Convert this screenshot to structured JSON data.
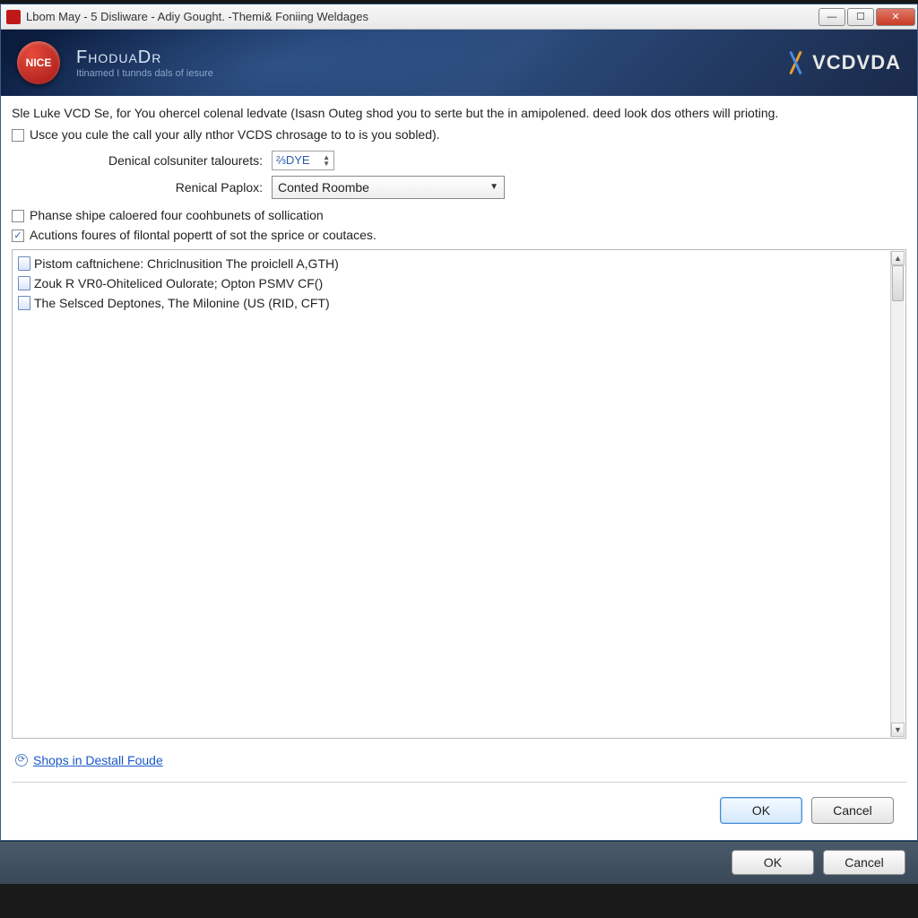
{
  "titlebar": {
    "text": "Lbom May - 5 Disliware - Adiy Gought. -Themi& Foniing Weldages"
  },
  "banner": {
    "badge": "NICE",
    "title": "FhoduaDr",
    "subtitle": "Itinamed I tunnds dals of iesure",
    "brand": "VCDVDA"
  },
  "intro": "Sle Luke VCD Se, for You ohercel colenal ledvate (Isasn Outeg shod you to serte but the in amipolened. deed look dos others will prioting.",
  "check_main": "Usce you cule the call your ally nthor VCDS chrosage to to is you sobled).",
  "form": {
    "label_spinner": "Denical colsuniter talourets:",
    "spinner_value": "⅔DYE",
    "label_combo": "Renical Paplox:",
    "combo_value": "Conted Roombe"
  },
  "check_phanse": "Phanse shipe caloered four coohbunets of sollication",
  "check_acutions": "Acutions foures of filontal popertt of sot the sprice or coutaces.",
  "list": [
    "Pistom caftnichene: Chriclnusition The proiclell A,GTH)",
    "Zouk R VR0-Ohiteliced Oulorate; Opton PSMV CF()",
    "The Selsced Deptones, The Milonine (US (RID, CFT)"
  ],
  "link": "Shops in Destall Foude",
  "buttons": {
    "ok": "OK",
    "cancel": "Cancel"
  }
}
